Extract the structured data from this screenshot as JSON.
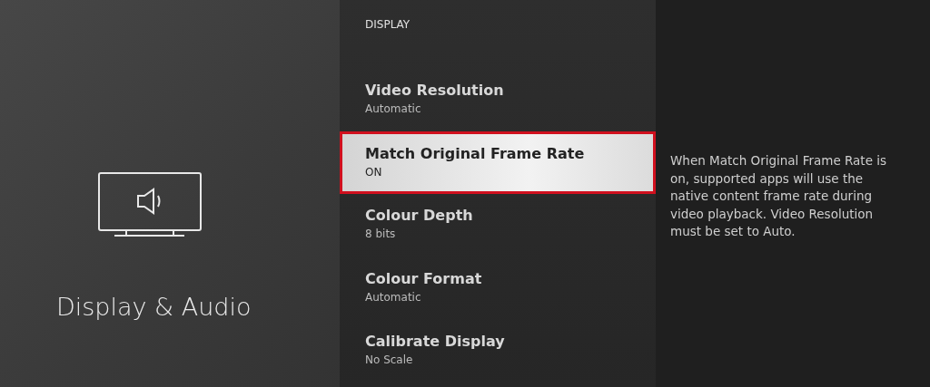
{
  "category": {
    "title": "Display & Audio"
  },
  "menu": {
    "heading": "DISPLAY",
    "items": [
      {
        "title": "Video Resolution",
        "value": "Automatic",
        "selected": false
      },
      {
        "title": "Match Original Frame Rate",
        "value": "ON",
        "selected": true
      },
      {
        "title": "Colour Depth",
        "value": "8 bits",
        "selected": false
      },
      {
        "title": "Colour Format",
        "value": "Automatic",
        "selected": false
      },
      {
        "title": "Calibrate Display",
        "value": "No Scale",
        "selected": false
      }
    ]
  },
  "description": "When Match Original Frame Rate is on, supported apps will use the native content frame rate during video playback. Video Resolution must be set to Auto."
}
